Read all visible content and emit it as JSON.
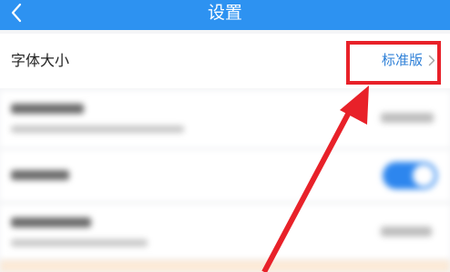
{
  "header": {
    "title": "设置",
    "back_icon": "chevron-left-icon"
  },
  "font_size_row": {
    "label": "字体大小",
    "value": "标准版",
    "chevron_icon": "chevron-right-icon"
  },
  "annotation": {
    "highlight_color": "#e82129"
  },
  "colors": {
    "header_bg": "#2d92f1",
    "accent": "#2d7fd7",
    "toggle_on": "#2d86ee"
  }
}
